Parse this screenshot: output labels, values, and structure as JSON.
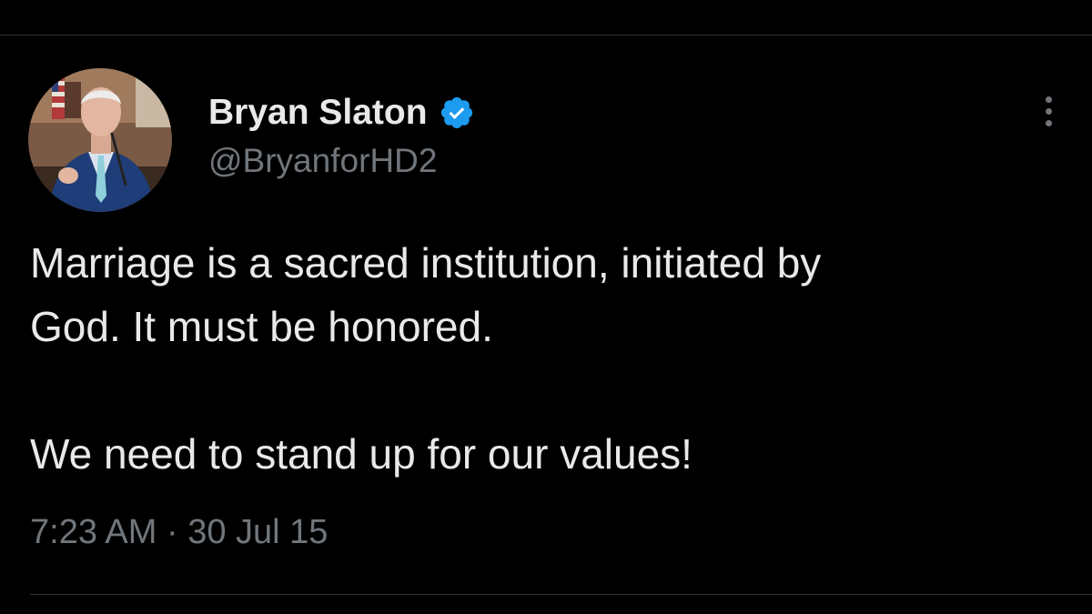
{
  "tweet": {
    "author": {
      "display_name": "Bryan Slaton",
      "handle": "@BryanforHD2",
      "verified": true,
      "verified_icon": "verified-badge-icon",
      "verified_color": "#1d9bf0"
    },
    "text_lines": [
      "Marriage is a sacred institution, initiated by",
      "God. It must be honored.",
      "",
      "We need to stand up for our values!"
    ],
    "time": "7:23 AM",
    "separator": "·",
    "date": "30 Jul 15",
    "more_icon": "more-options-icon"
  },
  "theme": {
    "background": "#000000",
    "text_primary": "#e7e9ea",
    "text_secondary": "#71767b",
    "divider": "#2f3336"
  }
}
